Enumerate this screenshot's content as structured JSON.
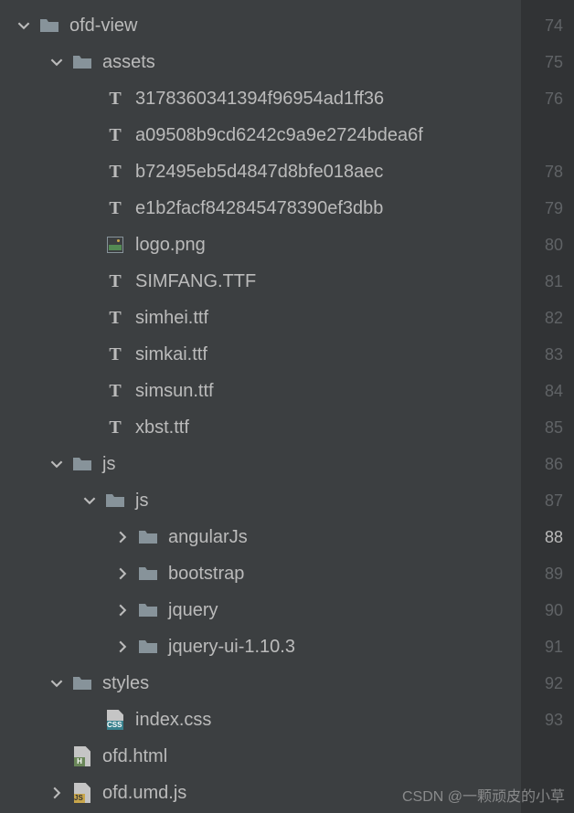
{
  "tree": {
    "root": {
      "name": "ofd-view",
      "expanded": true
    },
    "assets": {
      "name": "assets",
      "expanded": true
    },
    "assetsFiles": [
      "3178360341394f96954ad1ff36",
      "a09508b9cd6242c9a9e2724bdea6f",
      "b72495eb5d4847d8bfe018aec",
      "e1b2facf842845478390ef3dbb"
    ],
    "logo": "logo.png",
    "fonts": [
      "SIMFANG.TTF",
      "simhei.ttf",
      "simkai.ttf",
      "simsun.ttf",
      "xbst.ttf"
    ],
    "js": {
      "name": "js",
      "expanded": true
    },
    "jsInner": {
      "name": "js",
      "expanded": true
    },
    "jsFolders": [
      "angularJs",
      "bootstrap",
      "jquery",
      "jquery-ui-1.10.3"
    ],
    "styles": {
      "name": "styles",
      "expanded": true
    },
    "indexCss": "index.css",
    "ofdHtml": "ofd.html",
    "ofdUmd": "ofd.umd.js"
  },
  "lineNumbers": [
    "74",
    "75",
    "76",
    "",
    "78",
    "79",
    "80",
    "81",
    "82",
    "83",
    "84",
    "85",
    "86",
    "87",
    "88",
    "89",
    "90",
    "91",
    "92",
    "93",
    ""
  ],
  "selectedLine": "88",
  "watermark": "CSDN @一颗顽皮的小草"
}
